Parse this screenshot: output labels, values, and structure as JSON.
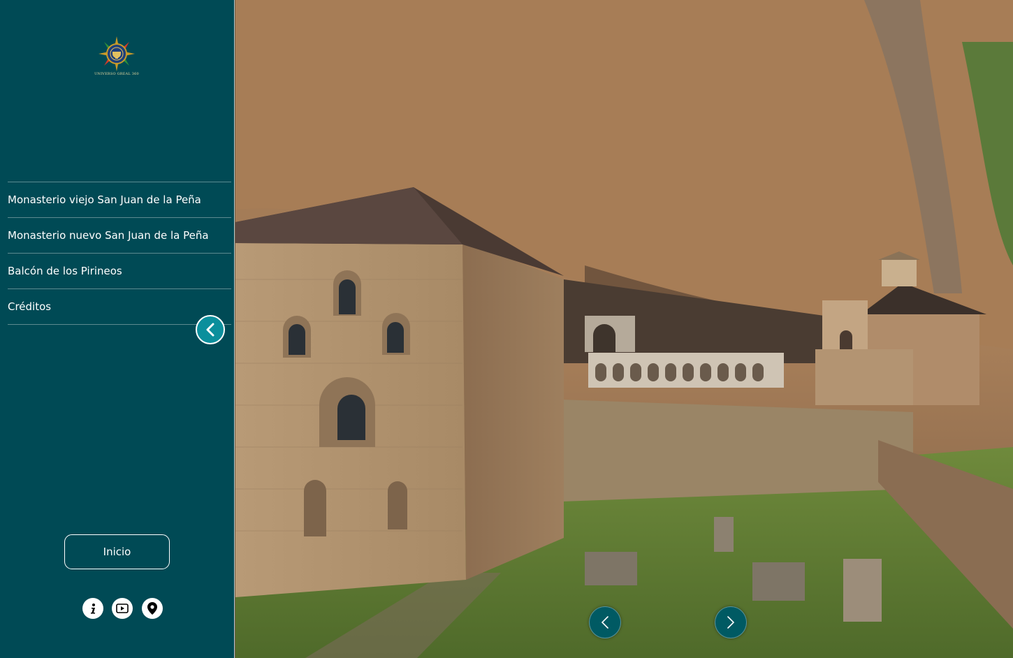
{
  "brand": {
    "logo_text": "UNIVERSO GREAL 360"
  },
  "menu": {
    "items": [
      {
        "label": "Monasterio viejo San Juan de la Peña"
      },
      {
        "label": "Monasterio nuevo San Juan de la Peña"
      },
      {
        "label": "Balcón de los Pirineos"
      },
      {
        "label": "Créditos"
      }
    ]
  },
  "home_button": {
    "label": "Inicio"
  },
  "footer_icons": [
    "info-icon",
    "video-icon",
    "map-pin-icon"
  ],
  "panorama": {
    "scene": "Monasterio viejo San Juan de la Peña"
  },
  "colors": {
    "sidebar_bg": "#004a55",
    "accent": "#0b8f9c",
    "nav_arrow_bg": "#005a63",
    "text": "#ffffff"
  }
}
